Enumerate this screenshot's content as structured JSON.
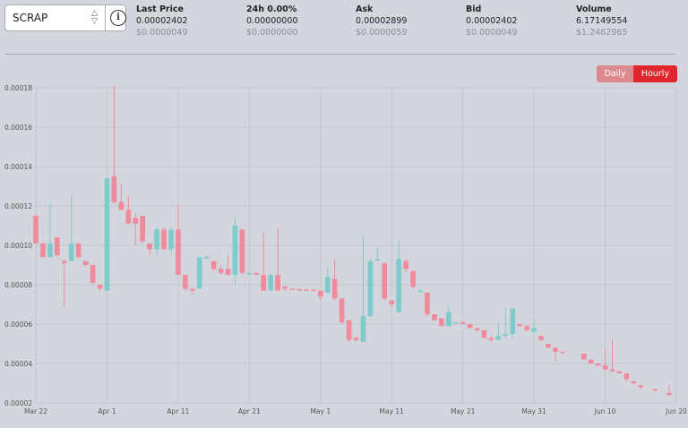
{
  "selector": {
    "symbol": "SCRAP",
    "updown_icon": "up-down-arrows-icon",
    "info_icon": "info-icon"
  },
  "stats": [
    {
      "label": "Last Price",
      "value": "0.00002402",
      "sub": "$0.0000049"
    },
    {
      "label": "24h 0.00%",
      "value": "0.00000000",
      "sub": "$0.0000000"
    },
    {
      "label": "Ask",
      "value": "0.00002899",
      "sub": "$0.0000059"
    },
    {
      "label": "Bid",
      "value": "0.00002402",
      "sub": "$0.0000049"
    },
    {
      "label": "Volume",
      "value": "6.17149554",
      "sub": "$1.2462965"
    }
  ],
  "toggle": {
    "daily": "Daily",
    "hourly": "Hourly",
    "active": "hourly"
  },
  "colors": {
    "up": "#7fcbcb",
    "down": "#f08a9c",
    "grid": "#bfc2c8",
    "active_button": "#e0252d",
    "inactive_button": "#dc8a8d"
  },
  "chart_data": {
    "type": "candlestick",
    "y_ticks": [
      "0.00002",
      "0.00004",
      "0.00006",
      "0.00008",
      "0.00010",
      "0.00012",
      "0.00014",
      "0.00016",
      "0.00018"
    ],
    "ylim": [
      2e-05,
      0.00018
    ],
    "x_ticks": [
      "Mar 22",
      "Apr 1",
      "Apr 11",
      "Apr 21",
      "May 1",
      "May 11",
      "May 21",
      "May 31",
      "Jun 10",
      "Jun 20"
    ],
    "xlim": [
      "Mar 22",
      "Jun 20"
    ],
    "grid": true,
    "candles": [
      {
        "d": "Mar 22",
        "o": 0.000115,
        "h": 0.000115,
        "l": 0.000101,
        "c": 0.000101
      },
      {
        "d": "Mar 23",
        "o": 0.000101,
        "h": 0.000101,
        "l": 9.4e-05,
        "c": 9.4e-05
      },
      {
        "d": "Mar 24",
        "o": 9.4e-05,
        "h": 0.000121,
        "l": 9.4e-05,
        "c": 0.000101
      },
      {
        "d": "Mar 25",
        "o": 0.000104,
        "h": 0.000104,
        "l": 9.4e-05,
        "c": 9.5e-05
      },
      {
        "d": "Mar 26",
        "o": 9.2e-05,
        "h": 9.3e-05,
        "l": 6.9e-05,
        "c": 9.1e-05
      },
      {
        "d": "Mar 27",
        "o": 9.2e-05,
        "h": 0.000125,
        "l": 9.2e-05,
        "c": 0.000101
      },
      {
        "d": "Mar 28",
        "o": 0.000101,
        "h": 0.000101,
        "l": 9.3e-05,
        "c": 9.4e-05
      },
      {
        "d": "Mar 29",
        "o": 9.2e-05,
        "h": 9.2e-05,
        "l": 8.9e-05,
        "c": 9e-05
      },
      {
        "d": "Mar 30",
        "o": 9e-05,
        "h": 9e-05,
        "l": 8e-05,
        "c": 8.1e-05
      },
      {
        "d": "Mar 31",
        "o": 8e-05,
        "h": 8e-05,
        "l": 7.7e-05,
        "c": 7.8e-05
      },
      {
        "d": "Apr 1",
        "o": 7.7e-05,
        "h": 0.000134,
        "l": 7.7e-05,
        "c": 0.000134
      },
      {
        "d": "Apr 2",
        "o": 0.000135,
        "h": 0.000181,
        "l": 0.000121,
        "c": 0.000122
      },
      {
        "d": "Apr 3",
        "o": 0.000122,
        "h": 0.000131,
        "l": 0.000118,
        "c": 0.000118
      },
      {
        "d": "Apr 4",
        "o": 0.000118,
        "h": 0.000125,
        "l": 0.000111,
        "c": 0.000111
      },
      {
        "d": "Apr 5",
        "o": 0.000114,
        "h": 0.000116,
        "l": 0.0001,
        "c": 0.000111
      },
      {
        "d": "Apr 6",
        "o": 0.000115,
        "h": 0.000115,
        "l": 0.000101,
        "c": 0.000102
      },
      {
        "d": "Apr 7",
        "o": 0.000101,
        "h": 0.000101,
        "l": 9.5e-05,
        "c": 9.8e-05
      },
      {
        "d": "Apr 8",
        "o": 9.8e-05,
        "h": 0.000109,
        "l": 9.5e-05,
        "c": 0.000108
      },
      {
        "d": "Apr 9",
        "o": 0.000108,
        "h": 0.000109,
        "l": 9.8e-05,
        "c": 9.8e-05
      },
      {
        "d": "Apr 10",
        "o": 9.8e-05,
        "h": 0.000109,
        "l": 9.5e-05,
        "c": 0.000108
      },
      {
        "d": "Apr 11",
        "o": 0.000108,
        "h": 0.00012,
        "l": 8.5e-05,
        "c": 8.5e-05
      },
      {
        "d": "Apr 12",
        "o": 8.5e-05,
        "h": 8.5e-05,
        "l": 7.7e-05,
        "c": 7.8e-05
      },
      {
        "d": "Apr 13",
        "o": 7.8e-05,
        "h": 7.8e-05,
        "l": 7.5e-05,
        "c": 7.7e-05
      },
      {
        "d": "Apr 14",
        "o": 7.8e-05,
        "h": 9.4e-05,
        "l": 7.8e-05,
        "c": 9.4e-05
      },
      {
        "d": "Apr 15",
        "o": 9.4e-05,
        "h": 9.5e-05,
        "l": 9.3e-05,
        "c": 9.4e-05
      },
      {
        "d": "Apr 16",
        "o": 9.2e-05,
        "h": 9.2e-05,
        "l": 8.7e-05,
        "c": 8.8e-05
      },
      {
        "d": "Apr 17",
        "o": 8.8e-05,
        "h": 9e-05,
        "l": 8.5e-05,
        "c": 8.6e-05
      },
      {
        "d": "Apr 18",
        "o": 8.8e-05,
        "h": 9.5e-05,
        "l": 8.5e-05,
        "c": 8.5e-05
      },
      {
        "d": "Apr 19",
        "o": 8.5e-05,
        "h": 0.000114,
        "l": 8e-05,
        "c": 0.00011
      },
      {
        "d": "Apr 20",
        "o": 0.000108,
        "h": 0.000108,
        "l": 8.5e-05,
        "c": 8.6e-05
      },
      {
        "d": "Apr 21",
        "o": 8.6e-05,
        "h": 8.7e-05,
        "l": 8.5e-05,
        "c": 8.6e-05
      },
      {
        "d": "Apr 22",
        "o": 8.6e-05,
        "h": 8.6e-05,
        "l": 8.5e-05,
        "c": 8.5e-05
      },
      {
        "d": "Apr 23",
        "o": 8.5e-05,
        "h": 0.000106,
        "l": 7.7e-05,
        "c": 7.7e-05
      },
      {
        "d": "Apr 24",
        "o": 7.7e-05,
        "h": 8.6e-05,
        "l": 7.7e-05,
        "c": 8.5e-05
      },
      {
        "d": "Apr 25",
        "o": 8.5e-05,
        "h": 0.000109,
        "l": 7.7e-05,
        "c": 7.7e-05
      },
      {
        "d": "Apr 26",
        "o": 7.9e-05,
        "h": 7.9e-05,
        "l": 7.7e-05,
        "c": 7.8e-05
      },
      {
        "d": "Apr 27",
        "o": 7.8e-05,
        "h": 7.8e-05,
        "l": 7.75e-05,
        "c": 7.78e-05
      },
      {
        "d": "Apr 28",
        "o": 7.78e-05,
        "h": 7.78e-05,
        "l": 7.75e-05,
        "c": 7.76e-05
      },
      {
        "d": "Apr 29",
        "o": 7.76e-05,
        "h": 7.76e-05,
        "l": 7.75e-05,
        "c": 7.75e-05
      },
      {
        "d": "Apr 30",
        "o": 7.75e-05,
        "h": 7.75e-05,
        "l": 7.7e-05,
        "c": 7.71e-05
      },
      {
        "d": "May 1",
        "o": 7.7e-05,
        "h": 7.7e-05,
        "l": 7.2e-05,
        "c": 7.4e-05
      },
      {
        "d": "May 2",
        "o": 7.6e-05,
        "h": 8.9e-05,
        "l": 7.6e-05,
        "c": 8.4e-05
      },
      {
        "d": "May 3",
        "o": 8.3e-05,
        "h": 9.3e-05,
        "l": 7.2e-05,
        "c": 7.3e-05
      },
      {
        "d": "May 4",
        "o": 7.3e-05,
        "h": 7.3e-05,
        "l": 6e-05,
        "c": 6.1e-05
      },
      {
        "d": "May 5",
        "o": 6.2e-05,
        "h": 6.2e-05,
        "l": 5.1e-05,
        "c": 5.2e-05
      },
      {
        "d": "May 6",
        "o": 5.3e-05,
        "h": 5.4e-05,
        "l": 5.1e-05,
        "c": 5.2e-05
      },
      {
        "d": "May 7",
        "o": 5.1e-05,
        "h": 0.000105,
        "l": 5.1e-05,
        "c": 6.4e-05
      },
      {
        "d": "May 8",
        "o": 6.4e-05,
        "h": 9.3e-05,
        "l": 6.4e-05,
        "c": 9.2e-05
      },
      {
        "d": "May 9",
        "o": 9.3e-05,
        "h": 9.9e-05,
        "l": 9.3e-05,
        "c": 9.3e-05
      },
      {
        "d": "May 10",
        "o": 9.1e-05,
        "h": 9.1e-05,
        "l": 7.2e-05,
        "c": 7.3e-05
      },
      {
        "d": "May 11",
        "o": 7.2e-05,
        "h": 7.2e-05,
        "l": 6.9e-05,
        "c": 7e-05
      },
      {
        "d": "May 12",
        "o": 6.6e-05,
        "h": 0.000102,
        "l": 6.6e-05,
        "c": 9.3e-05
      },
      {
        "d": "May 13",
        "o": 9.2e-05,
        "h": 9.3e-05,
        "l": 8.6e-05,
        "c": 8.8e-05
      },
      {
        "d": "May 14",
        "o": 8.7e-05,
        "h": 8.7e-05,
        "l": 7.8e-05,
        "c": 7.9e-05
      },
      {
        "d": "May 15",
        "o": 7.7e-05,
        "h": 7.8e-05,
        "l": 7.7e-05,
        "c": 7.7e-05
      },
      {
        "d": "May 16",
        "o": 7.6e-05,
        "h": 7.6e-05,
        "l": 6.4e-05,
        "c": 6.5e-05
      },
      {
        "d": "May 17",
        "o": 6.5e-05,
        "h": 6.5e-05,
        "l": 6.2e-05,
        "c": 6.2e-05
      },
      {
        "d": "May 18",
        "o": 6.3e-05,
        "h": 6.3e-05,
        "l": 5.9e-05,
        "c": 5.9e-05
      },
      {
        "d": "May 19",
        "o": 5.9e-05,
        "h": 6.9e-05,
        "l": 5.9e-05,
        "c": 6.6e-05
      },
      {
        "d": "May 20",
        "o": 6.1e-05,
        "h": 6.1e-05,
        "l": 6e-05,
        "c": 6.1e-05
      },
      {
        "d": "May 21",
        "o": 6.1e-05,
        "h": 6.1e-05,
        "l": 6e-05,
        "c": 6e-05
      },
      {
        "d": "May 22",
        "o": 6e-05,
        "h": 6e-05,
        "l": 5.8e-05,
        "c": 5.8e-05
      },
      {
        "d": "May 23",
        "o": 5.8e-05,
        "h": 5.8e-05,
        "l": 5.6e-05,
        "c": 5.7e-05
      },
      {
        "d": "May 24",
        "o": 5.7e-05,
        "h": 5.7e-05,
        "l": 5.3e-05,
        "c": 5.3e-05
      },
      {
        "d": "May 25",
        "o": 5.3e-05,
        "h": 5.4e-05,
        "l": 5.1e-05,
        "c": 5.2e-05
      },
      {
        "d": "May 26",
        "o": 5.2e-05,
        "h": 6e-05,
        "l": 5.2e-05,
        "c": 5.4e-05
      },
      {
        "d": "May 27",
        "o": 5.4e-05,
        "h": 6.8e-05,
        "l": 5.3e-05,
        "c": 5.5e-05
      },
      {
        "d": "May 28",
        "o": 5.5e-05,
        "h": 6.8e-05,
        "l": 5.3e-05,
        "c": 6.8e-05
      },
      {
        "d": "May 29",
        "o": 6e-05,
        "h": 6e-05,
        "l": 5.9e-05,
        "c": 5.9e-05
      },
      {
        "d": "May 30",
        "o": 5.9e-05,
        "h": 5.9e-05,
        "l": 5.6e-05,
        "c": 5.7e-05
      },
      {
        "d": "May 31",
        "o": 5.6e-05,
        "h": 6.2e-05,
        "l": 5.6e-05,
        "c": 5.8e-05
      },
      {
        "d": "Jun 1",
        "o": 5.4e-05,
        "h": 5.4e-05,
        "l": 5.1e-05,
        "c": 5.2e-05
      },
      {
        "d": "Jun 2",
        "o": 5e-05,
        "h": 5e-05,
        "l": 4.8e-05,
        "c": 4.8e-05
      },
      {
        "d": "Jun 3",
        "o": 4.8e-05,
        "h": 4.8e-05,
        "l": 4.1e-05,
        "c": 4.6e-05
      },
      {
        "d": "Jun 4",
        "o": 4.6e-05,
        "h": 4.6e-05,
        "l": 4.5e-05,
        "c": 4.55e-05
      },
      {
        "d": "Jun 7",
        "o": 4.5e-05,
        "h": 4.5e-05,
        "l": 4.2e-05,
        "c": 4.2e-05
      },
      {
        "d": "Jun 8",
        "o": 4.2e-05,
        "h": 4.2e-05,
        "l": 4e-05,
        "c": 4e-05
      },
      {
        "d": "Jun 9",
        "o": 4e-05,
        "h": 4e-05,
        "l": 3.9e-05,
        "c": 3.9e-05
      },
      {
        "d": "Jun 10",
        "o": 3.9e-05,
        "h": 4.7e-05,
        "l": 3.8e-05,
        "c": 3.7e-05
      },
      {
        "d": "Jun 11",
        "o": 3.7e-05,
        "h": 5.2e-05,
        "l": 3.7e-05,
        "c": 3.6e-05
      },
      {
        "d": "Jun 12",
        "o": 3.6e-05,
        "h": 3.6e-05,
        "l": 3.5e-05,
        "c": 3.5e-05
      },
      {
        "d": "Jun 13",
        "o": 3.5e-05,
        "h": 3.5e-05,
        "l": 3.1e-05,
        "c": 3.2e-05
      },
      {
        "d": "Jun 14",
        "o": 3.1e-05,
        "h": 3.1e-05,
        "l": 2.9e-05,
        "c": 3e-05
      },
      {
        "d": "Jun 15",
        "o": 2.9e-05,
        "h": 2.9e-05,
        "l": 2.7e-05,
        "c": 2.8e-05
      },
      {
        "d": "Jun 17",
        "o": 2.7e-05,
        "h": 2.7e-05,
        "l": 2.6e-05,
        "c": 2.65e-05
      },
      {
        "d": "Jun 19",
        "o": 2.5e-05,
        "h": 2.9e-05,
        "l": 2.4e-05,
        "c": 2.4e-05
      }
    ]
  }
}
